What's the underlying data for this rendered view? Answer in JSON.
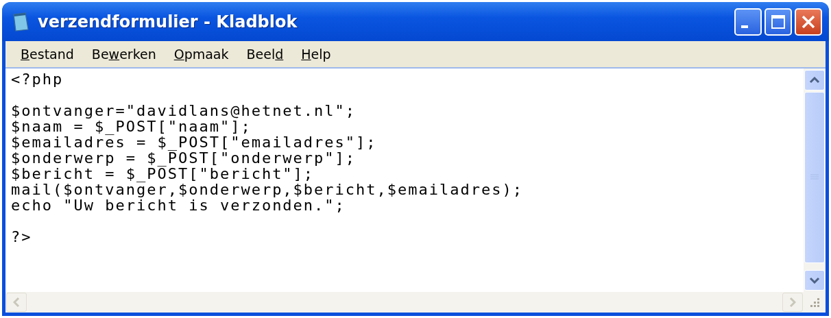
{
  "window": {
    "title": "verzendformulier - Kladblok"
  },
  "menu": [
    {
      "key": "B",
      "post": "estand"
    },
    {
      "pre": "Be",
      "key": "w",
      "post": "erken"
    },
    {
      "key": "O",
      "post": "pmaak"
    },
    {
      "pre": "Beel",
      "key": "d"
    },
    {
      "key": "H",
      "post": "elp"
    }
  ],
  "editor": {
    "content": "<?php\n\n$ontvanger=\"davidlans@hetnet.nl\";\n$naam = $_POST[\"naam\"];\n$emailadres = $_POST[\"emailadres\"];\n$onderwerp = $_POST[\"onderwerp\"];\n$bericht = $_POST[\"bericht\"];\nmail($ontvanger,$onderwerp,$bericht,$emailadres);\necho \"Uw bericht is verzonden.\";\n\n?>"
  }
}
